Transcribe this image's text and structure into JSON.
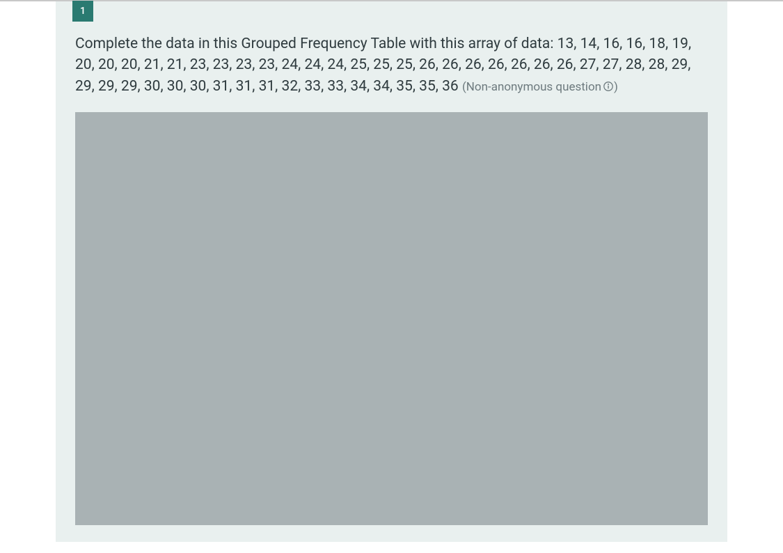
{
  "question": {
    "number": "1",
    "text": "Complete the data in this Grouped Frequency Table with this array of data: 13, 14, 16, 16, 18, 19, 20, 20, 20, 21, 21, 23, 23, 23, 23, 24, 24, 24, 25, 25, 25, 26, 26, 26, 26, 26, 26, 26, 27, 27, 28, 28, 29, 29, 29, 29, 30, 30, 30, 31, 31, 31, 32, 33, 33, 34, 34, 35, 35, 36",
    "meta": "(Non-anonymous question",
    "meta_close": ")"
  }
}
